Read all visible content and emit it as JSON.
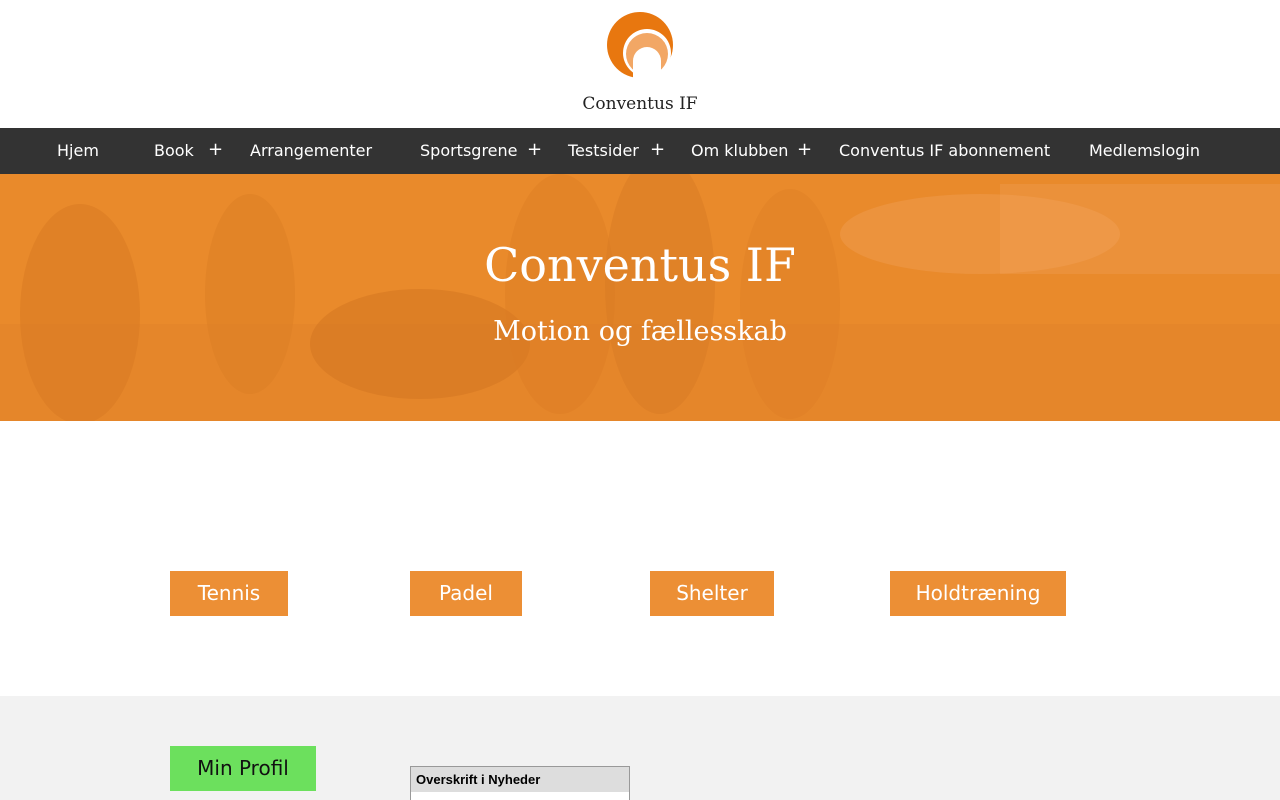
{
  "site": {
    "name": "Conventus IF",
    "brand_color": "#e98a2b",
    "logo_icon": "circle-logo-icon"
  },
  "nav": {
    "items": [
      {
        "label": "Hjem",
        "has_submenu": false
      },
      {
        "label": "Book",
        "has_submenu": true
      },
      {
        "label": "Arrangementer",
        "has_submenu": false
      },
      {
        "label": "Sportsgrene",
        "has_submenu": true
      },
      {
        "label": "Testsider",
        "has_submenu": true
      },
      {
        "label": "Om klubben",
        "has_submenu": true
      },
      {
        "label": "Conventus IF abonnement",
        "has_submenu": false
      },
      {
        "label": "Medlemslogin",
        "has_submenu": false
      }
    ],
    "expand_glyph": "+"
  },
  "hero": {
    "title": "Conventus IF",
    "subtitle": "Motion og fællesskab"
  },
  "sports_buttons": [
    "Tennis",
    "Padel",
    "Shelter",
    "Holdtræning"
  ],
  "profile": {
    "label": "Min Profil",
    "color": "#6ce05d"
  },
  "news": {
    "heading": "Overskrift i Nyheder"
  }
}
